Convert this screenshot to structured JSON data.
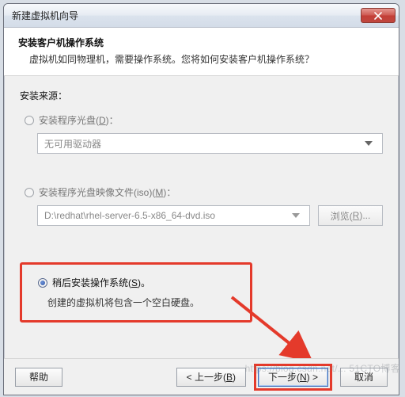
{
  "window": {
    "title": "新建虚拟机向导"
  },
  "header": {
    "title": "安装客户机操作系统",
    "subtitle": "虚拟机如同物理机，需要操作系统。您将如何安装客户机操作系统？"
  },
  "source_label": "安装来源：",
  "opt1": {
    "label_pre": "安装程序光盘(",
    "mnemonic": "D",
    "label_post": ")：",
    "select_value": "无可用驱动器"
  },
  "opt2": {
    "label_pre": "安装程序光盘映像文件(iso)(",
    "mnemonic": "M",
    "label_post": ")：",
    "path_value": "D:\\redhat\\rhel-server-6.5-x86_64-dvd.iso",
    "browse_pre": "浏览(",
    "browse_mn": "R",
    "browse_post": ")..."
  },
  "opt3": {
    "label_pre": "稍后安装操作系统(",
    "mnemonic": "S",
    "label_post": ")。",
    "hint": "创建的虚拟机将包含一个空白硬盘。"
  },
  "buttons": {
    "help": "帮助",
    "back_pre": "< 上一步(",
    "back_mn": "B",
    "back_post": ")",
    "next_pre": "下一步(",
    "next_mn": "N",
    "next_post": ") >",
    "cancel": "取消"
  },
  "watermark": "https://blog.csdn.net/... 51CTO博客"
}
